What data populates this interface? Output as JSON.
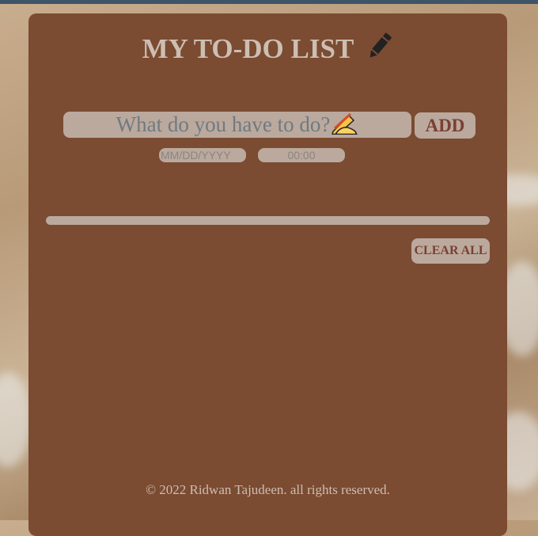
{
  "app": {
    "title": "MY TO-DO LIST",
    "title_icon": "pencil-icon"
  },
  "form": {
    "task_placeholder": "What do you have to do?",
    "task_emoji": "writing-hand-icon",
    "add_label": "ADD",
    "date_placeholder": "MM/DD/YYYY",
    "time_value": "00:00"
  },
  "actions": {
    "clear_all_label": "CLEAR ALL"
  },
  "footer": {
    "text": "© 2022 Ridwan Tajudeen. all rights reserved."
  },
  "colors": {
    "card_background": "#7b4b32",
    "control_background": "#bba99d",
    "title_text": "#cdbeb2",
    "button_text": "#7b3f33",
    "placeholder_text": "#707a82"
  }
}
